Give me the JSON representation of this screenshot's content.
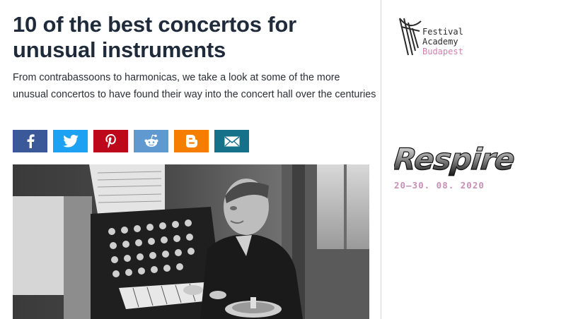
{
  "article": {
    "title_lines": [
      "10 of the best concertos for",
      "unusual instruments"
    ],
    "standfirst_lines": [
      "From contrabassoons to harmonicas, we take a look at some of the more",
      "unusual concertos to have found their way into the concert hall over the centuries"
    ]
  },
  "share": {
    "buttons": [
      {
        "name": "facebook",
        "icon": "facebook-icon",
        "color": "#3b5998"
      },
      {
        "name": "twitter",
        "icon": "twitter-icon",
        "color": "#1da1f2"
      },
      {
        "name": "pinterest",
        "icon": "pinterest-icon",
        "color": "#bd081c"
      },
      {
        "name": "reddit",
        "icon": "reddit-icon",
        "color": "#5f99cf"
      },
      {
        "name": "blogger",
        "icon": "blogger-icon",
        "color": "#f57d00"
      },
      {
        "name": "email",
        "icon": "email-icon",
        "color": "#15708a"
      }
    ]
  },
  "hero_image": {
    "description": "black-and-white-photo-man-at-instrument-console"
  },
  "ad": {
    "brand_lines": [
      "Festival",
      "Academy",
      "Budapest"
    ],
    "campaign": "Respire",
    "dates": "20–30. 08. 2020",
    "accent_color": "#c98fb6"
  }
}
